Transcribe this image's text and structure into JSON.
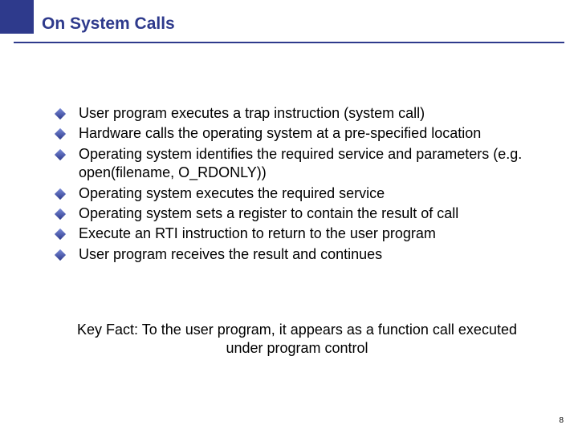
{
  "slide": {
    "title": "On System Calls",
    "bullets": [
      "User program executes a trap instruction (system call)",
      "Hardware calls the operating system at a pre-specified location",
      "Operating system identifies the required service and parameters (e.g. open(filename, O_RDONLY))",
      "Operating system executes the required service",
      "Operating system sets a register to contain the result of call",
      "Execute an RTI instruction to return to the user program",
      "User program receives the result and continues"
    ],
    "keyfact": "Key Fact: To the user program, it appears as a function call executed under program control",
    "page_number": "8"
  }
}
